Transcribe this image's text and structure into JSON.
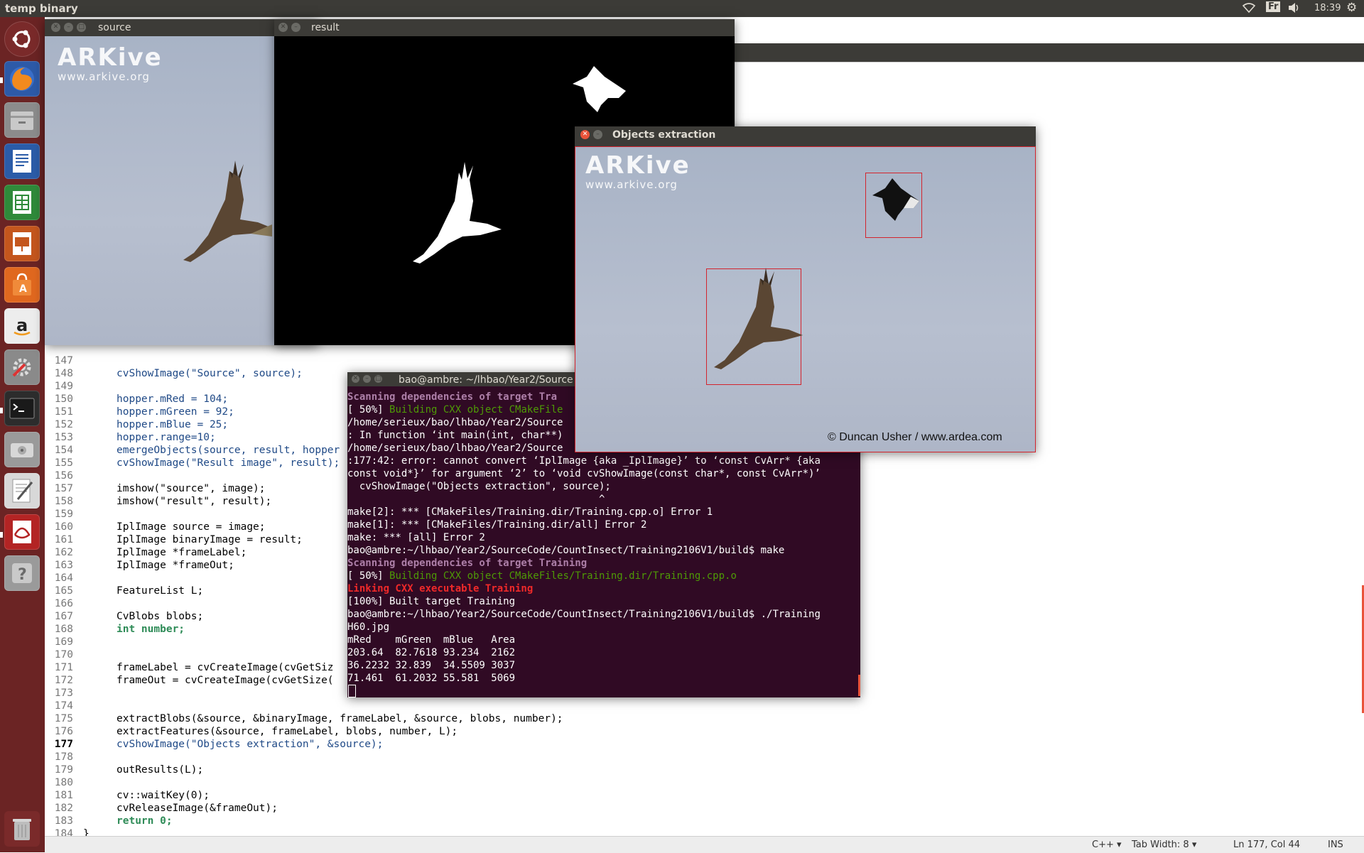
{
  "topbar": {
    "title": "temp binary",
    "keyboard": "Fr",
    "clock": "18:39"
  },
  "launcher": {
    "icons": [
      "ubuntu-dash-icon",
      "firefox-icon",
      "files-icon",
      "writer-icon",
      "calc-icon",
      "impress-icon",
      "software-center-icon",
      "amazon-icon",
      "system-settings-icon",
      "terminal-icon",
      "disk-icon",
      "text-editor-icon",
      "document-viewer-icon",
      "help-icon",
      "trash-icon"
    ]
  },
  "editor": {
    "lines": [
      {
        "n": "147",
        "t": ""
      },
      {
        "n": "148",
        "t": "cvShowImage(\"Source\", source);"
      },
      {
        "n": "149",
        "t": ""
      },
      {
        "n": "150",
        "t": "hopper.mRed = 104;"
      },
      {
        "n": "151",
        "t": "hopper.mGreen = 92;"
      },
      {
        "n": "152",
        "t": "hopper.mBlue = 25;"
      },
      {
        "n": "153",
        "t": "hopper.range=10;"
      },
      {
        "n": "154",
        "t": "emergeObjects(source, result, hopper"
      },
      {
        "n": "155",
        "t": "cvShowImage(\"Result image\", result);"
      },
      {
        "n": "156",
        "t": ""
      },
      {
        "n": "157",
        "t": "imshow(\"source\", image);"
      },
      {
        "n": "158",
        "t": "imshow(\"result\", result);"
      },
      {
        "n": "159",
        "t": ""
      },
      {
        "n": "160",
        "t": "IplImage source = image;"
      },
      {
        "n": "161",
        "t": "IplImage binaryImage = result;"
      },
      {
        "n": "162",
        "t": "IplImage *frameLabel;"
      },
      {
        "n": "163",
        "t": "IplImage *frameOut;"
      },
      {
        "n": "164",
        "t": ""
      },
      {
        "n": "165",
        "t": "FeatureList L;"
      },
      {
        "n": "166",
        "t": ""
      },
      {
        "n": "167",
        "t": "CvBlobs blobs;"
      },
      {
        "n": "168",
        "t": "int number;"
      },
      {
        "n": "169",
        "t": ""
      },
      {
        "n": "170",
        "t": ""
      },
      {
        "n": "171",
        "t": "frameLabel = cvCreateImage(cvGetSiz"
      },
      {
        "n": "172",
        "t": "frameOut = cvCreateImage(cvGetSize("
      },
      {
        "n": "173",
        "t": ""
      },
      {
        "n": "174",
        "t": ""
      },
      {
        "n": "175",
        "t": "extractBlobs(&source, &binaryImage, frameLabel, &source, blobs, number);"
      },
      {
        "n": "176",
        "t": "extractFeatures(&source, frameLabel, blobs, number, L);"
      },
      {
        "n": "177",
        "t": "cvShowImage(\"Objects extraction\", &source);"
      },
      {
        "n": "178",
        "t": ""
      },
      {
        "n": "179",
        "t": "outResults(L);"
      },
      {
        "n": "180",
        "t": ""
      },
      {
        "n": "181",
        "t": "cv::waitKey(0);"
      },
      {
        "n": "182",
        "t": "cvReleaseImage(&frameOut);"
      },
      {
        "n": "183",
        "t": "return 0;"
      },
      {
        "n": "184",
        "t": "}"
      }
    ],
    "status": {
      "language": "C++ ▾",
      "tab_width": "Tab Width: 8 ▾",
      "position": "Ln 177, Col 44",
      "mode": "INS"
    }
  },
  "windows": {
    "source": {
      "title": "source",
      "logo": "ARKive",
      "logo_url": "www.arkive.org"
    },
    "result": {
      "title": "result"
    },
    "objects": {
      "title": "Objects extraction",
      "logo": "ARKive",
      "logo_url": "www.arkive.org",
      "credit": "© Duncan Usher / www.ardea.com"
    },
    "terminal": {
      "title": "bao@ambre: ~/lhbao/Year2/Source",
      "lines": [
        {
          "c": "t-bold",
          "t": "Scanning dependencies of target Tra"
        },
        {
          "c": "",
          "t": "[ 50%] ",
          "g": "Building CXX object CMakeFile"
        },
        {
          "c": "",
          "t": "/home/serieux/bao/lhbao/Year2/Source"
        },
        {
          "c": "",
          "t": ": In function ‘int main(int, char**)"
        },
        {
          "c": "",
          "t": "/home/serieux/bao/lhbao/Year2/Source"
        },
        {
          "c": "",
          "t": ":177:42: error: cannot convert ‘IplImage {aka _IplImage}’ to ‘const CvArr* {aka"
        },
        {
          "c": "",
          "t": "const void*}’ for argument ‘2’ to ‘void cvShowImage(const char*, const CvArr*)’"
        },
        {
          "c": "",
          "t": "  cvShowImage(\"Objects extraction\", source);"
        },
        {
          "c": "",
          "t": "                                          ^"
        },
        {
          "c": "",
          "t": "make[2]: *** [CMakeFiles/Training.dir/Training.cpp.o] Error 1"
        },
        {
          "c": "",
          "t": "make[1]: *** [CMakeFiles/Training.dir/all] Error 2"
        },
        {
          "c": "",
          "t": "make: *** [all] Error 2"
        },
        {
          "c": "",
          "t": "bao@ambre:~/lhbao/Year2/SourceCode/CountInsect/Training2106V1/build$ make"
        },
        {
          "c": "t-bold",
          "t": "Scanning dependencies of target Training"
        },
        {
          "c": "",
          "t": "[ 50%] ",
          "g": "Building CXX object CMakeFiles/Training.dir/Training.cpp.o"
        },
        {
          "c": "t-red",
          "t": "Linking CXX executable Training"
        },
        {
          "c": "",
          "t": "[100%] Built target Training"
        },
        {
          "c": "",
          "t": "bao@ambre:~/lhbao/Year2/SourceCode/CountInsect/Training2106V1/build$ ./Training"
        },
        {
          "c": "",
          "t": "H60.jpg"
        },
        {
          "c": "",
          "t": "mRed    mGreen  mBlue   Area"
        },
        {
          "c": "",
          "t": "203.64  82.7618 93.234  2162"
        },
        {
          "c": "",
          "t": "36.2232 32.839  34.5509 3037"
        },
        {
          "c": "",
          "t": "71.461  61.2032 55.581  5069"
        }
      ]
    }
  }
}
